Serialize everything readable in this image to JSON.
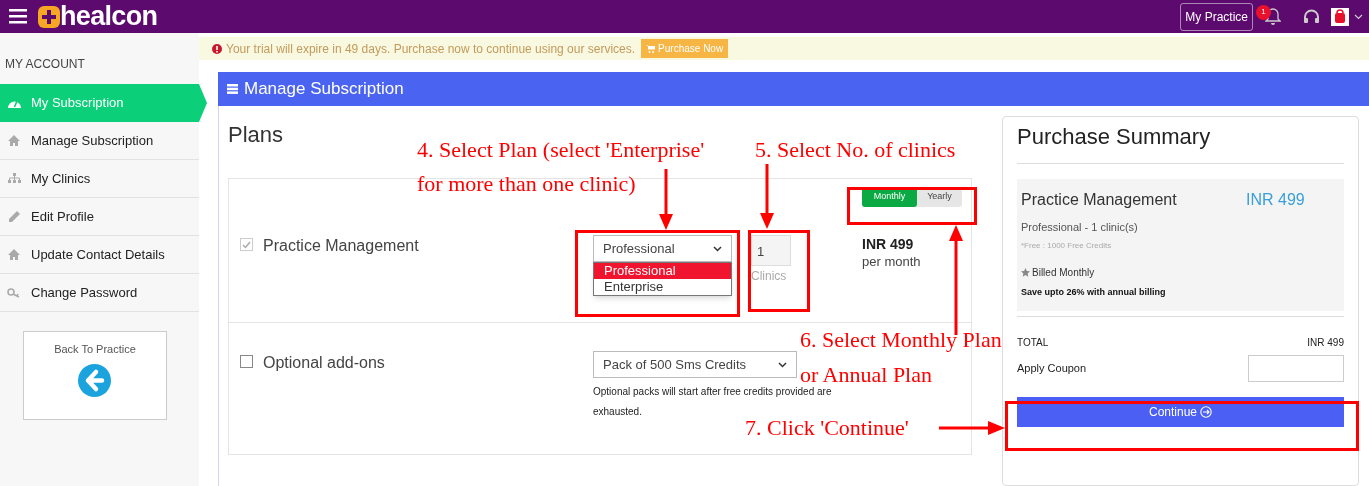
{
  "topbar": {
    "logo": "healcon",
    "practice_button": "My Practice",
    "notification_count": "1"
  },
  "sidebar": {
    "heading": "MY ACCOUNT",
    "items": [
      {
        "label": "My Subscription",
        "selected": true
      },
      {
        "label": "Manage Subscription",
        "selected": false
      },
      {
        "label": "My Clinics",
        "selected": false
      },
      {
        "label": "Edit Profile",
        "selected": false
      },
      {
        "label": "Update Contact Details",
        "selected": false
      },
      {
        "label": "Change Password",
        "selected": false
      }
    ],
    "back_button": "Back To Practice"
  },
  "alert": {
    "message": "Your trial will expire in 49 days. Purchase now to continue using our services.",
    "button": "Purchase Now"
  },
  "panel": {
    "title": "Manage Subscription"
  },
  "plans": {
    "title": "Plans",
    "rows": [
      {
        "kind": "plan",
        "checked": true,
        "name": "Practice Management",
        "select": {
          "value": "Professional",
          "options": [
            {
              "label": "Professional",
              "selected": true
            },
            {
              "label": "Enterprise",
              "selected": false
            }
          ]
        },
        "clinics": {
          "value": "1",
          "label": "Clinics"
        },
        "price": "INR 499",
        "period": "per month",
        "billing": [
          {
            "label": "Monthly",
            "selected": true
          },
          {
            "label": "Yearly",
            "selected": false
          }
        ]
      },
      {
        "kind": "addon",
        "checked": false,
        "name": "Optional add-ons",
        "select": {
          "value": "Pack of 500 Sms Credits"
        },
        "note": "Optional packs will start after free credits provided are exhausted."
      }
    ]
  },
  "summary": {
    "title": "Purchase Summary",
    "item": "Practice Management",
    "item_price": "INR 499",
    "plan": "Professional - 1 clinic(s)",
    "free": "*Free : 1000 Free Credits",
    "billed": "Billed Monthly",
    "saving": "Save upto 26% with annual billing",
    "total_label": "TOTAL",
    "total": "INR 499",
    "coupon_label": "Apply Coupon",
    "button": "Continue"
  },
  "annotations": [
    {
      "lines": [
        "4. Select Plan (select 'Enterprise'",
        "for more than one clinic)"
      ]
    },
    {
      "lines": [
        "5. Select No. of clinics"
      ]
    },
    {
      "lines": [
        "6. Select Monthly Plan",
        "or Annual Plan"
      ]
    },
    {
      "lines": [
        "7. Click 'Continue'"
      ]
    }
  ]
}
